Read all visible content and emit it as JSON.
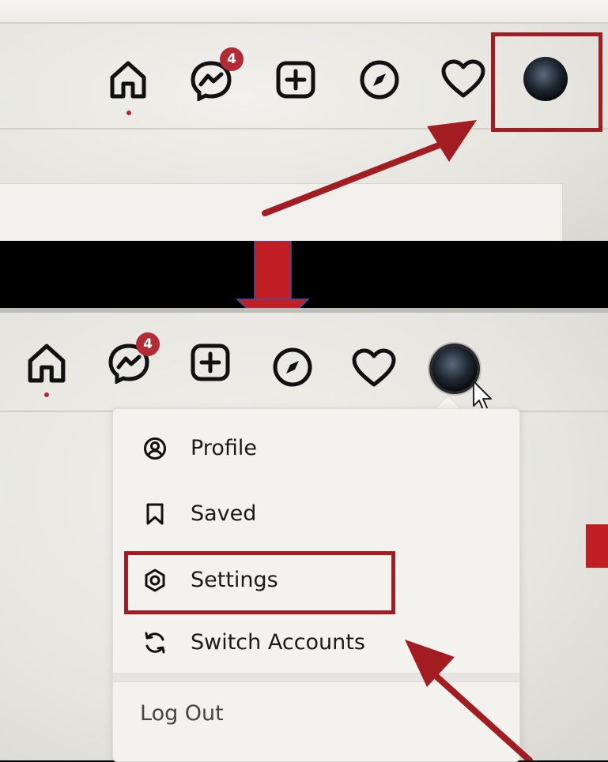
{
  "top_screenshot": {
    "nav": [
      {
        "icon": "home-icon",
        "active": true
      },
      {
        "icon": "messenger-icon",
        "badge": "4"
      },
      {
        "icon": "new-post-icon"
      },
      {
        "icon": "explore-compass-icon"
      },
      {
        "icon": "activity-heart-icon"
      },
      {
        "icon": "profile-avatar"
      }
    ]
  },
  "bottom_screenshot": {
    "nav": [
      {
        "icon": "home-icon",
        "active": true
      },
      {
        "icon": "messenger-icon",
        "badge": "4"
      },
      {
        "icon": "new-post-icon"
      },
      {
        "icon": "explore-compass-icon"
      },
      {
        "icon": "activity-heart-icon"
      },
      {
        "icon": "profile-avatar"
      }
    ],
    "menu": {
      "items": [
        {
          "label": "Profile",
          "icon": "profile-circle-icon"
        },
        {
          "label": "Saved",
          "icon": "bookmark-icon"
        },
        {
          "label": "Settings",
          "icon": "settings-gear-icon",
          "highlighted": true
        },
        {
          "label": "Switch Accounts",
          "icon": "switch-accounts-icon"
        }
      ],
      "logout_label": "Log Out"
    }
  },
  "colors": {
    "callout": "#a11d22",
    "badge": "#b22a33",
    "background": "#000000",
    "screen": "#ecebe7"
  }
}
